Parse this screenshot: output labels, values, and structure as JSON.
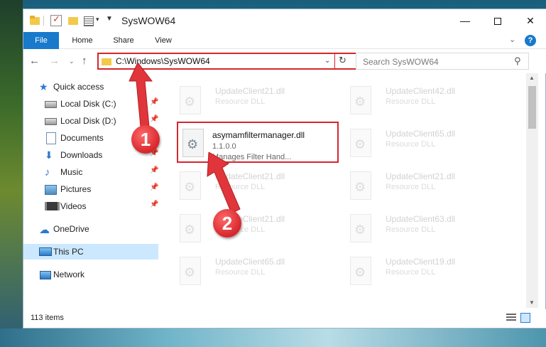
{
  "window": {
    "title": "SysWOW64",
    "minimize": "—",
    "maximize": "",
    "close": "✕"
  },
  "quick_access_toolbar": {
    "dropdown": "▾",
    "pin": "▼"
  },
  "ribbon": {
    "tabs": [
      "File",
      "Home",
      "Share",
      "View"
    ],
    "collapse": "⌄",
    "help": "?"
  },
  "navigation": {
    "back": "←",
    "forward": "→",
    "recent": "⌄",
    "up": "↑",
    "address": "C:\\Windows\\SysWOW64",
    "address_dropdown": "⌄",
    "refresh": "↻",
    "search_placeholder": "Search SysWOW64",
    "search_icon": "⚲"
  },
  "sidebar": {
    "items": [
      {
        "label": "Quick access",
        "icon": "star-icon",
        "pinned": false
      },
      {
        "label": "Local Disk (C:)",
        "icon": "drive-icon",
        "pinned": true
      },
      {
        "label": "Local Disk (D:)",
        "icon": "drive-icon",
        "pinned": true
      },
      {
        "label": "Documents",
        "icon": "documents-icon",
        "pinned": true
      },
      {
        "label": "Downloads",
        "icon": "download-icon",
        "pinned": true
      },
      {
        "label": "Music",
        "icon": "music-icon",
        "pinned": true
      },
      {
        "label": "Pictures",
        "icon": "pictures-icon",
        "pinned": true
      },
      {
        "label": "Videos",
        "icon": "videos-icon",
        "pinned": true
      },
      {
        "label": "OneDrive",
        "icon": "cloud-icon",
        "pinned": false
      },
      {
        "label": "This PC",
        "icon": "pc-icon",
        "pinned": false,
        "selected": true
      },
      {
        "label": "Network",
        "icon": "network-icon",
        "pinned": false
      }
    ],
    "pin_glyph": "📌"
  },
  "files": {
    "left_column": [
      {
        "name": "UpdateClient21.dll",
        "desc": "Resource DLL"
      },
      {
        "name": "UpdateClient21.dll",
        "desc": "Resource DLL"
      },
      {
        "name": "UpdateClient21.dll",
        "desc": "Resource DLL"
      },
      {
        "name": "UpdateClient65.dll",
        "desc": "Resource DLL"
      }
    ],
    "right_column": [
      {
        "name": "UpdateClient42.dll",
        "desc": "Resource DLL"
      },
      {
        "name": "UpdateClient65.dll",
        "desc": "Resource DLL"
      },
      {
        "name": "UpdateClient21.dll",
        "desc": "Resource DLL"
      },
      {
        "name": "UpdateClient63.dll",
        "desc": "Resource DLL"
      },
      {
        "name": "UpdateClient19.dll",
        "desc": "Resource DLL"
      }
    ],
    "focused": {
      "name": "asymamfiltermanager.dll",
      "version": "1.1.0.0",
      "desc": "Manages Filter Hand..."
    }
  },
  "scrollbar": {
    "up": "▲",
    "down": "▼"
  },
  "status": {
    "item_count": "113 items"
  },
  "annotations": {
    "step1": "1",
    "step2": "2"
  },
  "colors": {
    "accent": "#1979ca",
    "highlight": "#d6262c",
    "selected": "#cce8ff"
  }
}
